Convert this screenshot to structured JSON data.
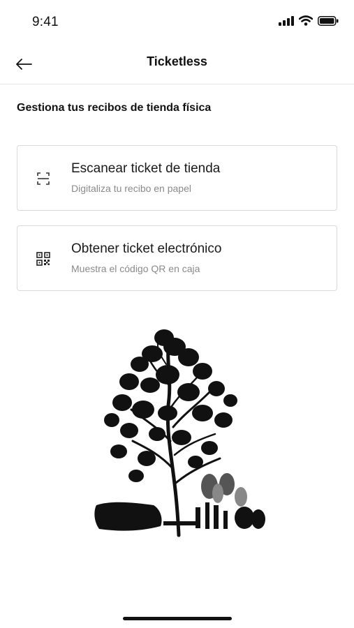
{
  "status_bar": {
    "time": "9:41",
    "icons": [
      "cellular-signal-icon",
      "wifi-icon",
      "battery-icon"
    ]
  },
  "nav": {
    "back_icon": "arrow-left-icon",
    "title": "Ticketless"
  },
  "section": {
    "title": "Gestiona tus recibos de tienda física"
  },
  "options": [
    {
      "icon": "scan-frame-icon",
      "title": "Escanear ticket de tienda",
      "subtitle": "Digitaliza tu recibo en papel"
    },
    {
      "icon": "qr-code-icon",
      "title": "Obtener ticket electrónico",
      "subtitle": "Muestra el código QR en caja"
    }
  ],
  "illustration": "tree-illustration",
  "colors": {
    "text_primary": "#111111",
    "text_secondary": "#8a8a8a",
    "border": "#d9d9d9",
    "background": "#ffffff"
  }
}
